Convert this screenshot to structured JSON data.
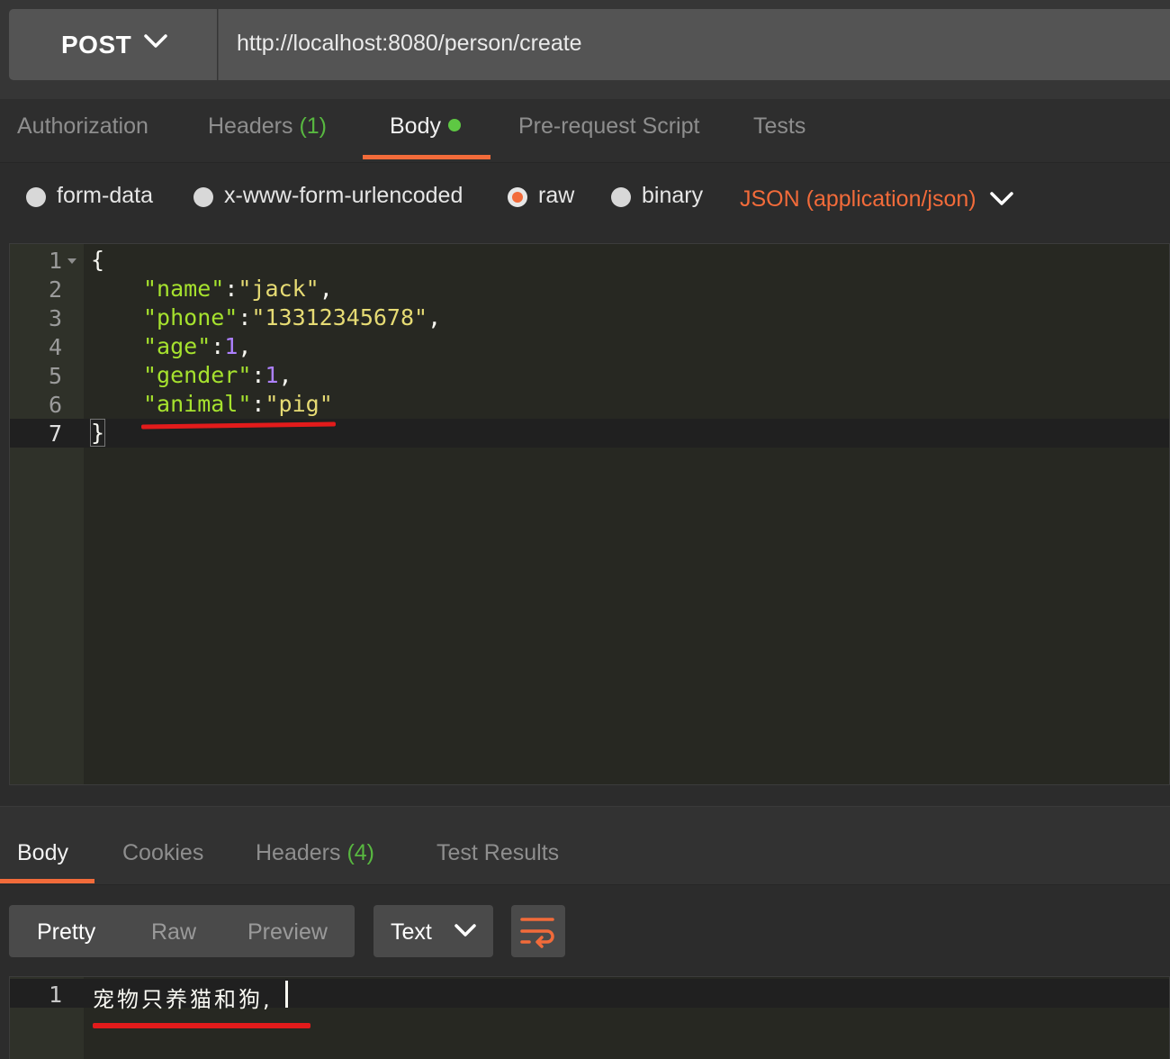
{
  "request": {
    "method": "POST",
    "url": "http://localhost:8080/person/create"
  },
  "request_tabs": {
    "authorization": "Authorization",
    "headers": "Headers",
    "headers_count": "(1)",
    "body": "Body",
    "pre_request": "Pre-request Script",
    "tests": "Tests",
    "active": "Body"
  },
  "body_type": {
    "options": [
      "form-data",
      "x-www-form-urlencoded",
      "raw",
      "binary"
    ],
    "selected": "raw",
    "content_type": "JSON (application/json)"
  },
  "editor": {
    "line_numbers": [
      "1",
      "2",
      "3",
      "4",
      "5",
      "6",
      "7"
    ],
    "open_brace": "{",
    "close_brace": "}",
    "fields": [
      {
        "key": "\"name\"",
        "value": "\"jack\"",
        "suffix": ","
      },
      {
        "key": "\"phone\"",
        "value": "\"13312345678\"",
        "suffix": ","
      },
      {
        "key": "\"age\"",
        "value": "1",
        "suffix": ","
      },
      {
        "key": "\"gender\"",
        "value": "1",
        "suffix": ","
      },
      {
        "key": "\"animal\"",
        "value": "\"pig\"",
        "suffix": ""
      }
    ],
    "colon": ":"
  },
  "response_tabs": {
    "body": "Body",
    "cookies": "Cookies",
    "headers": "Headers",
    "headers_count": "(4)",
    "test_results": "Test Results",
    "active": "Body"
  },
  "response_view": {
    "modes": [
      "Pretty",
      "Raw",
      "Preview"
    ],
    "selected_mode": "Pretty",
    "format": "Text"
  },
  "response_body": {
    "line_number": "1",
    "text": "宠物只养猫和狗,"
  },
  "colors": {
    "accent": "#f26b3a",
    "count_green": "#58b840",
    "dot_green": "#5ec843",
    "annotation_red": "#e21b1b"
  }
}
